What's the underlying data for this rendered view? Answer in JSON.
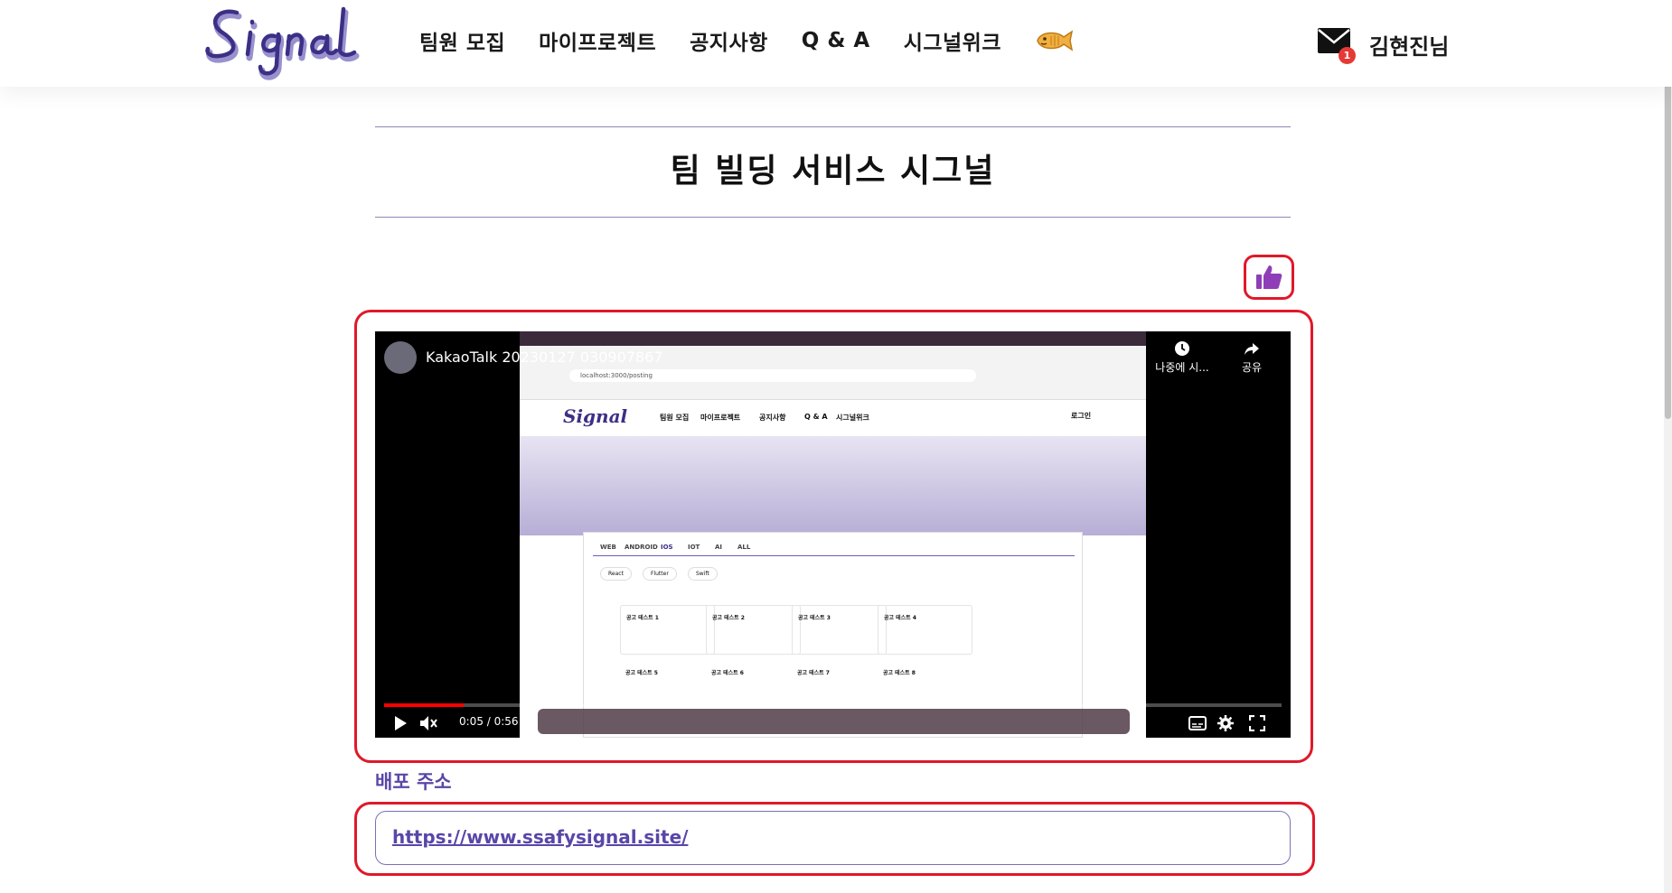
{
  "header": {
    "logo_text": "Signal",
    "nav": [
      {
        "label": "팀원 모집"
      },
      {
        "label": "마이프로젝트"
      },
      {
        "label": "공지사항"
      },
      {
        "label": "Q & A"
      },
      {
        "label": "시그널위크"
      }
    ],
    "fish_icon": "fish-bread-icon",
    "mail_icon": "envelope-icon",
    "mail_badge_count": "1",
    "username": "김현진님"
  },
  "page": {
    "title": "팀 빌딩 서비스 시그널",
    "like_icon": "thumbs-up-icon"
  },
  "video": {
    "title": "KakaoTalk 20230127 030907867",
    "time": "0:05 / 0:56",
    "progress_fraction": 0.089,
    "watch_later_label": "나중에 시...",
    "share_label": "공유",
    "embedded": {
      "url": "localhost:3000/posting",
      "site_nav": [
        "팀원 모집",
        "마이프로젝트",
        "공지사항",
        "Q & A",
        "시그널위크"
      ],
      "login": "로그인",
      "tabs": [
        "WEB",
        "ANDROID",
        "IOS",
        "IOT",
        "AI",
        "ALL"
      ],
      "stacks": [
        "React",
        "Flutter",
        "Swift"
      ],
      "cards": [
        "공고 테스트 1",
        "공고 테스트 2",
        "공고 테스트 3",
        "공고 테스트 4"
      ],
      "cards_row2": [
        "공고 테스트 5",
        "공고 테스트 6",
        "공고 테스트 7",
        "공고 테스트 8"
      ]
    }
  },
  "deploy": {
    "label": "배포 주소",
    "url": "https://www.ssafysignal.site/"
  },
  "colors": {
    "brand_purple": "#5a46a8",
    "highlight_red": "#e0182a",
    "like_purple": "#8e3fb8"
  }
}
